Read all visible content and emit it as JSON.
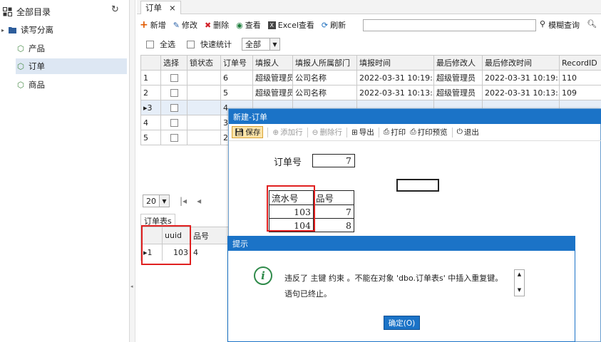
{
  "tree": {
    "root": "全部目录",
    "group": "读写分离",
    "items": [
      "产品",
      "订单",
      "商品"
    ]
  },
  "tab": {
    "title": "订单",
    "close": "×"
  },
  "toolbar": {
    "add": "新增",
    "edit": "修改",
    "del": "删除",
    "view": "查看",
    "excel": "Excel查看",
    "refresh": "刷新",
    "fuzzy": "模糊查询"
  },
  "filters": {
    "select_all": "全选",
    "quick_stats": "快速统计",
    "scope": "全部"
  },
  "grid": {
    "columns": [
      "",
      "选择",
      "锁状态",
      "订单号",
      "填报人",
      "填报人所属部门",
      "填报时间",
      "最后修改人",
      "最后修改时间",
      "RecordID"
    ],
    "rows": [
      {
        "n": "1",
        "order": "6",
        "reporter": "超级管理员",
        "dept": "公司名称",
        "time": "2022-03-31 10:19:59",
        "modifier": "超级管理员",
        "mtime": "2022-03-31 10:19:59",
        "rid": "110"
      },
      {
        "n": "2",
        "order": "5",
        "reporter": "超级管理员",
        "dept": "公司名称",
        "time": "2022-03-31 10:13:31",
        "modifier": "超级管理员",
        "mtime": "2022-03-31 10:13:31",
        "rid": "109"
      },
      {
        "n": "▸3",
        "order": "4",
        "reporter": "",
        "dept": "",
        "time": "",
        "modifier": "",
        "mtime": "",
        "rid": ""
      },
      {
        "n": "4",
        "order": "3",
        "reporter": "",
        "dept": "",
        "time": "",
        "modifier": "",
        "mtime": "",
        "rid": ""
      },
      {
        "n": "5",
        "order": "2",
        "reporter": "",
        "dept": "",
        "time": "",
        "modifier": "",
        "mtime": "",
        "rid": ""
      }
    ]
  },
  "pager": {
    "page_size": "20"
  },
  "subtab": "订单表s",
  "subgrid": {
    "columns": [
      "",
      "uuid",
      "品号"
    ],
    "rows": [
      {
        "n": "▸1",
        "uuid": "103",
        "code": "4"
      }
    ]
  },
  "dialog": {
    "title": "新建-订单",
    "save": "保存",
    "add_row": "添加行",
    "del_row": "删除行",
    "export": "导出",
    "print": "打印",
    "preview": "打印预览",
    "exit": "退出",
    "order_label": "订单号",
    "order_value": "7",
    "detail_headers": [
      "流水号",
      "品号"
    ],
    "detail_rows": [
      {
        "serial": "103",
        "code": "7"
      },
      {
        "serial": "104",
        "code": "8"
      }
    ]
  },
  "message": {
    "title": "提示",
    "line1": "违反了 主键 约束 。不能在对象 'dbo.订单表s' 中插入重复键。",
    "line2": "语句已终止。",
    "ok": "确定(O)"
  },
  "colors": {
    "accent": "#1b73c7",
    "highlight": "#e02020"
  }
}
